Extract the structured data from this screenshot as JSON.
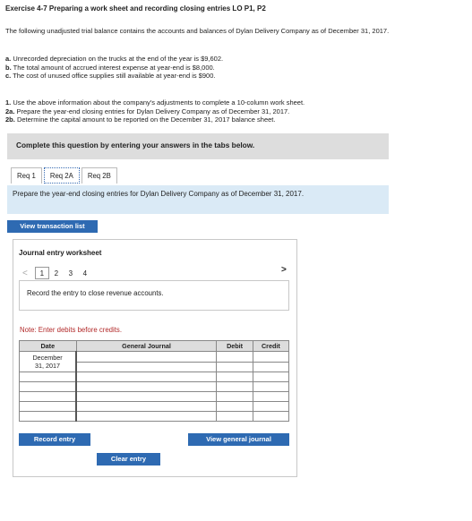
{
  "exercise": {
    "title": "Exercise 4-7 Preparing a work sheet and recording closing entries LO P1, P2",
    "intro": "The following unadjusted trial balance contains the accounts and balances of Dylan Delivery Company as of December 31, 2017.",
    "facts": [
      {
        "label": "a.",
        "text": "Unrecorded depreciation on the trucks at the end of the year is $9,602."
      },
      {
        "label": "b.",
        "text": "The total amount of accrued interest expense at year-end is $8,000."
      },
      {
        "label": "c.",
        "text": "The cost of unused office supplies still available at year-end is $900."
      }
    ],
    "requirements": [
      {
        "label": "1.",
        "text": "Use the above information about the company's adjustments to complete a 10-column work sheet."
      },
      {
        "label": "2a.",
        "text": "Prepare the year-end closing entries for Dylan Delivery Company as of December 31, 2017."
      },
      {
        "label": "2b.",
        "text": "Determine the capital amount to be reported on the December 31, 2017 balance sheet."
      }
    ]
  },
  "banner": "Complete this question by entering your answers in the tabs below.",
  "tabs": [
    "Req 1",
    "Req 2A",
    "Req 2B"
  ],
  "prompt": "Prepare the year-end closing entries for Dylan Delivery Company as of December 31, 2017.",
  "view_transaction_list": "View transaction list",
  "worksheet": {
    "title": "Journal entry worksheet",
    "pages": [
      "1",
      "2",
      "3",
      "4"
    ],
    "current_page": "1",
    "prev_arrow": "<",
    "next_arrow": ">",
    "instruction": "Record the entry to close revenue accounts.",
    "note": "Note: Enter debits before credits.",
    "columns": {
      "date": "Date",
      "journal": "General Journal",
      "debit": "Debit",
      "credit": "Credit"
    },
    "date_line1": "December",
    "date_line2": "31, 2017"
  },
  "buttons": {
    "record": "Record entry",
    "clear": "Clear entry",
    "view_general": "View general journal"
  }
}
